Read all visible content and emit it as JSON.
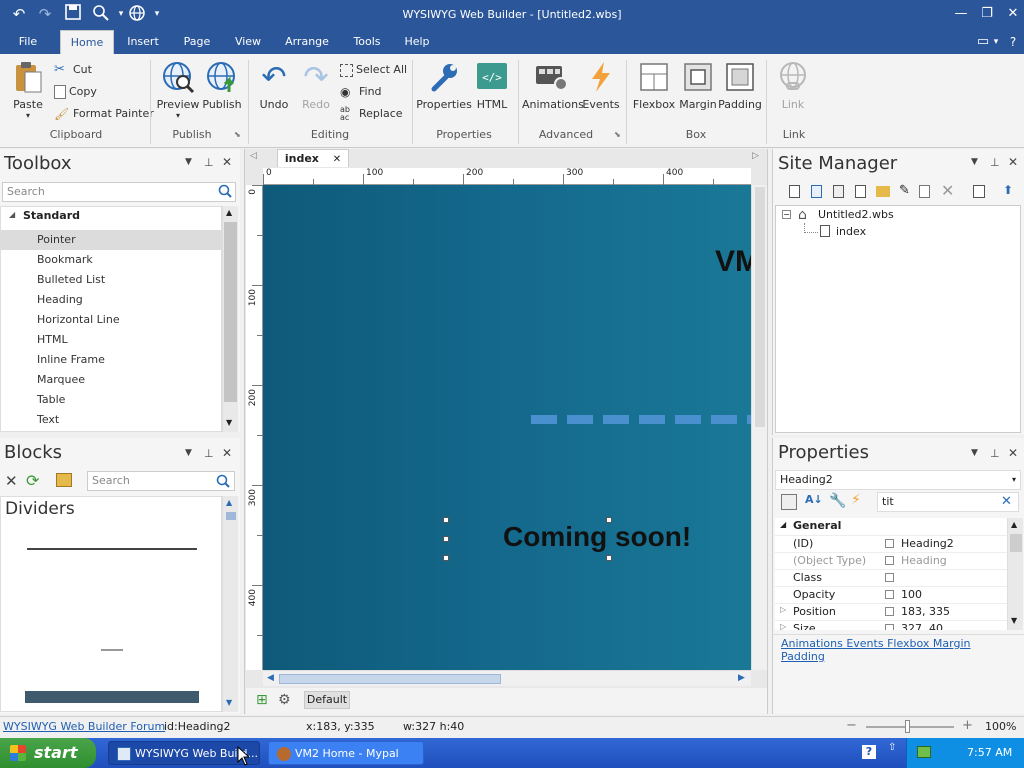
{
  "window": {
    "title": "WYSIWYG Web Builder - [Untitled2.wbs]"
  },
  "menu": {
    "items": [
      "File",
      "Home",
      "Insert",
      "Page",
      "View",
      "Arrange",
      "Tools",
      "Help"
    ]
  },
  "ribbon": {
    "clipboard": {
      "paste": "Paste",
      "cut": "Cut",
      "copy": "Copy",
      "format_painter": "Format Painter",
      "label": "Clipboard"
    },
    "publish": {
      "preview": "Preview",
      "publish": "Publish",
      "label": "Publish"
    },
    "editing": {
      "undo": "Undo",
      "redo": "Redo",
      "select_all": "Select All",
      "find": "Find",
      "replace": "Replace",
      "label": "Editing"
    },
    "properties": {
      "properties": "Properties",
      "html": "HTML",
      "label": "Properties"
    },
    "advanced": {
      "animations": "Animations",
      "events": "Events",
      "label": "Advanced"
    },
    "box": {
      "flexbox": "Flexbox",
      "margin": "Margin",
      "padding": "Padding",
      "label": "Box"
    },
    "link": {
      "link": "Link",
      "label": "Link"
    }
  },
  "toolbox": {
    "title": "Toolbox",
    "search_placeholder": "Search",
    "category": "Standard",
    "items": [
      "Pointer",
      "Bookmark",
      "Bulleted List",
      "Heading",
      "Horizontal Line",
      "HTML",
      "Inline Frame",
      "Marquee",
      "Table",
      "Text"
    ]
  },
  "blocks": {
    "title": "Blocks",
    "search_placeholder": "Search",
    "category": "Dividers"
  },
  "editor": {
    "tab": "index",
    "ruler_h": [
      "0",
      "100",
      "200",
      "300",
      "400"
    ],
    "ruler_v": [
      "0",
      "100",
      "200",
      "300",
      "400"
    ],
    "canvas_text_top": "VM",
    "heading_text": "Coming soon!",
    "breakpoint": "Default"
  },
  "site_manager": {
    "title": "Site Manager",
    "root": "Untitled2.wbs",
    "page": "index"
  },
  "properties": {
    "title": "Properties",
    "selected_object": "Heading2",
    "filter_value": "tit",
    "section": "General",
    "rows": [
      {
        "name": "(ID)",
        "value": "Heading2"
      },
      {
        "name": "(Object Type)",
        "value": "Heading"
      },
      {
        "name": "Class",
        "value": ""
      },
      {
        "name": "Opacity",
        "value": "100"
      },
      {
        "name": "Position",
        "value": "183, 335"
      },
      {
        "name": "Size",
        "value": "327, 40"
      }
    ],
    "links": [
      "Animations",
      "Events",
      "Flexbox",
      "Margin",
      "Padding"
    ]
  },
  "status": {
    "forum_link": "WYSIWYG Web Builder Forum",
    "object_id": "id:Heading2",
    "coords": "x:183, y:335",
    "size": "w:327 h:40",
    "zoom": "100%"
  },
  "taskbar": {
    "start": "start",
    "tasks": [
      "WYSIWYG Web Build...",
      "VM2 Home - Mypal"
    ],
    "time": "7:57 AM"
  }
}
